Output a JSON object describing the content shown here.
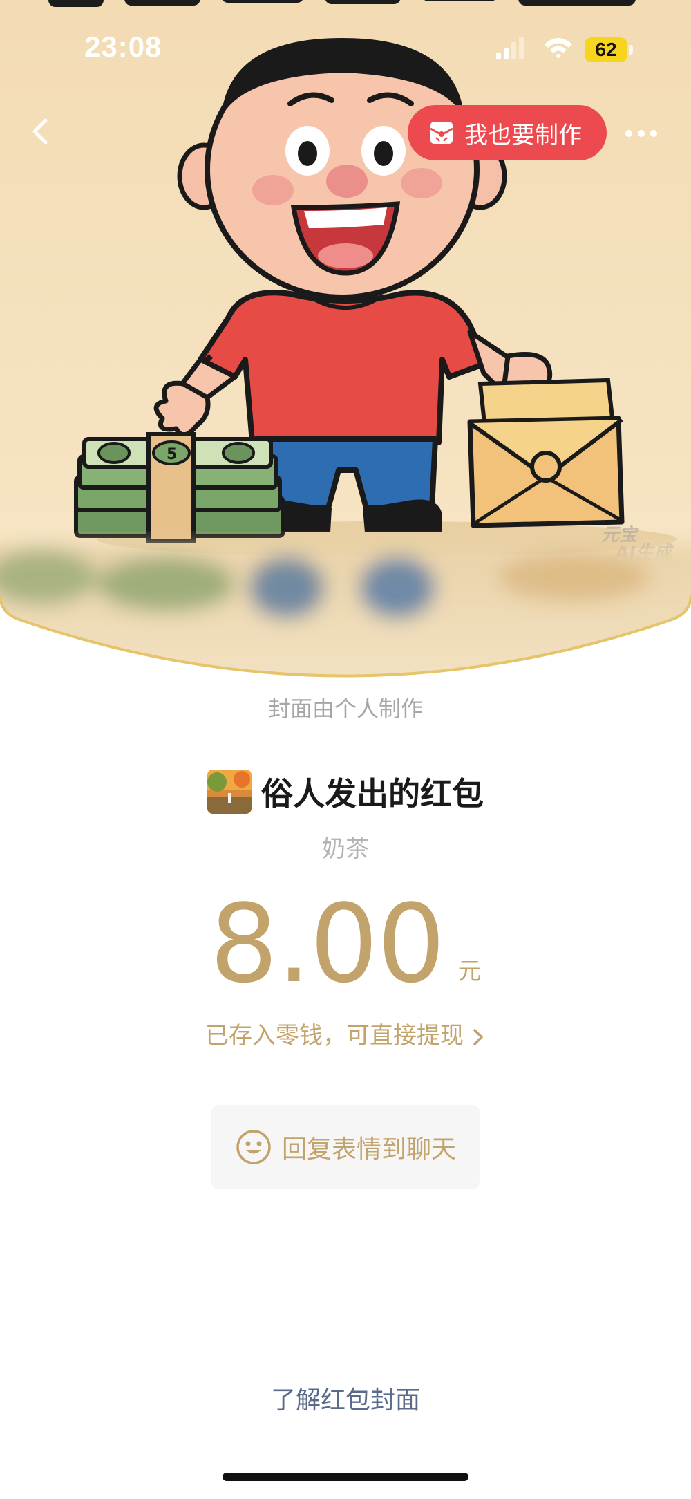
{
  "status_bar": {
    "time": "23:08",
    "battery": "62"
  },
  "nav": {
    "make_button_label": "我也要制作"
  },
  "cover": {
    "watermark_line1": "元宝",
    "watermark_line2": "AI生成",
    "banknote_mark": "5"
  },
  "cover_note": "封面由个人制作",
  "sender": {
    "title": "俗人发出的红包"
  },
  "blessing": "奶茶",
  "amount": {
    "value": "8.00",
    "unit": "元"
  },
  "wallet_link": "已存入零钱，可直接提现",
  "reply_button": "回复表情到聊天",
  "learn_link": "了解红包封面",
  "colors": {
    "gold": "#c2a36b",
    "red_button": "#ec4a4f",
    "cover_bg": "#f6e3c0"
  }
}
